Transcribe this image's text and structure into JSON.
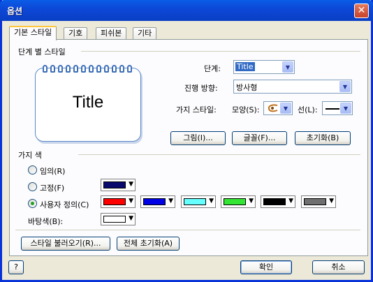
{
  "window": {
    "title": "옵션",
    "close_glyph": "✕"
  },
  "tabs": [
    {
      "label": "기본 스타일"
    },
    {
      "label": "기호"
    },
    {
      "label": "피쉬본"
    },
    {
      "label": "기타"
    }
  ],
  "level_style": {
    "group_label": "단계 별 스타일",
    "preview_title": "Title",
    "level_label": "단계:",
    "level_value": "Title",
    "direction_label": "진행 방향:",
    "direction_value": "방사형",
    "branch_style_label": "가지 스타일:",
    "shape_label": "모양(S):",
    "line_label": "선(L):",
    "image_button": "그림(I)...",
    "font_button": "글꼴(F)...",
    "reset_button": "초기화(B)"
  },
  "branch_color": {
    "group_label": "가지 색",
    "random_label": "임의(R)",
    "fixed_label": "고정(F)",
    "custom_label": "사용자 정의(C)",
    "background_label": "바탕색(B):",
    "selected": "custom",
    "fixed_color": "#0a0a6e",
    "custom_colors": [
      "#ff0000",
      "#0000e6",
      "#66ffff",
      "#33e633",
      "#000000",
      "#707070"
    ],
    "background_color": "#ffffff"
  },
  "footer": {
    "load_style_button": "스타일 불러오기(R)...",
    "reset_all_button": "전체 초기화(A)",
    "help_button": "?",
    "ok_button": "확인",
    "cancel_button": "취소"
  }
}
